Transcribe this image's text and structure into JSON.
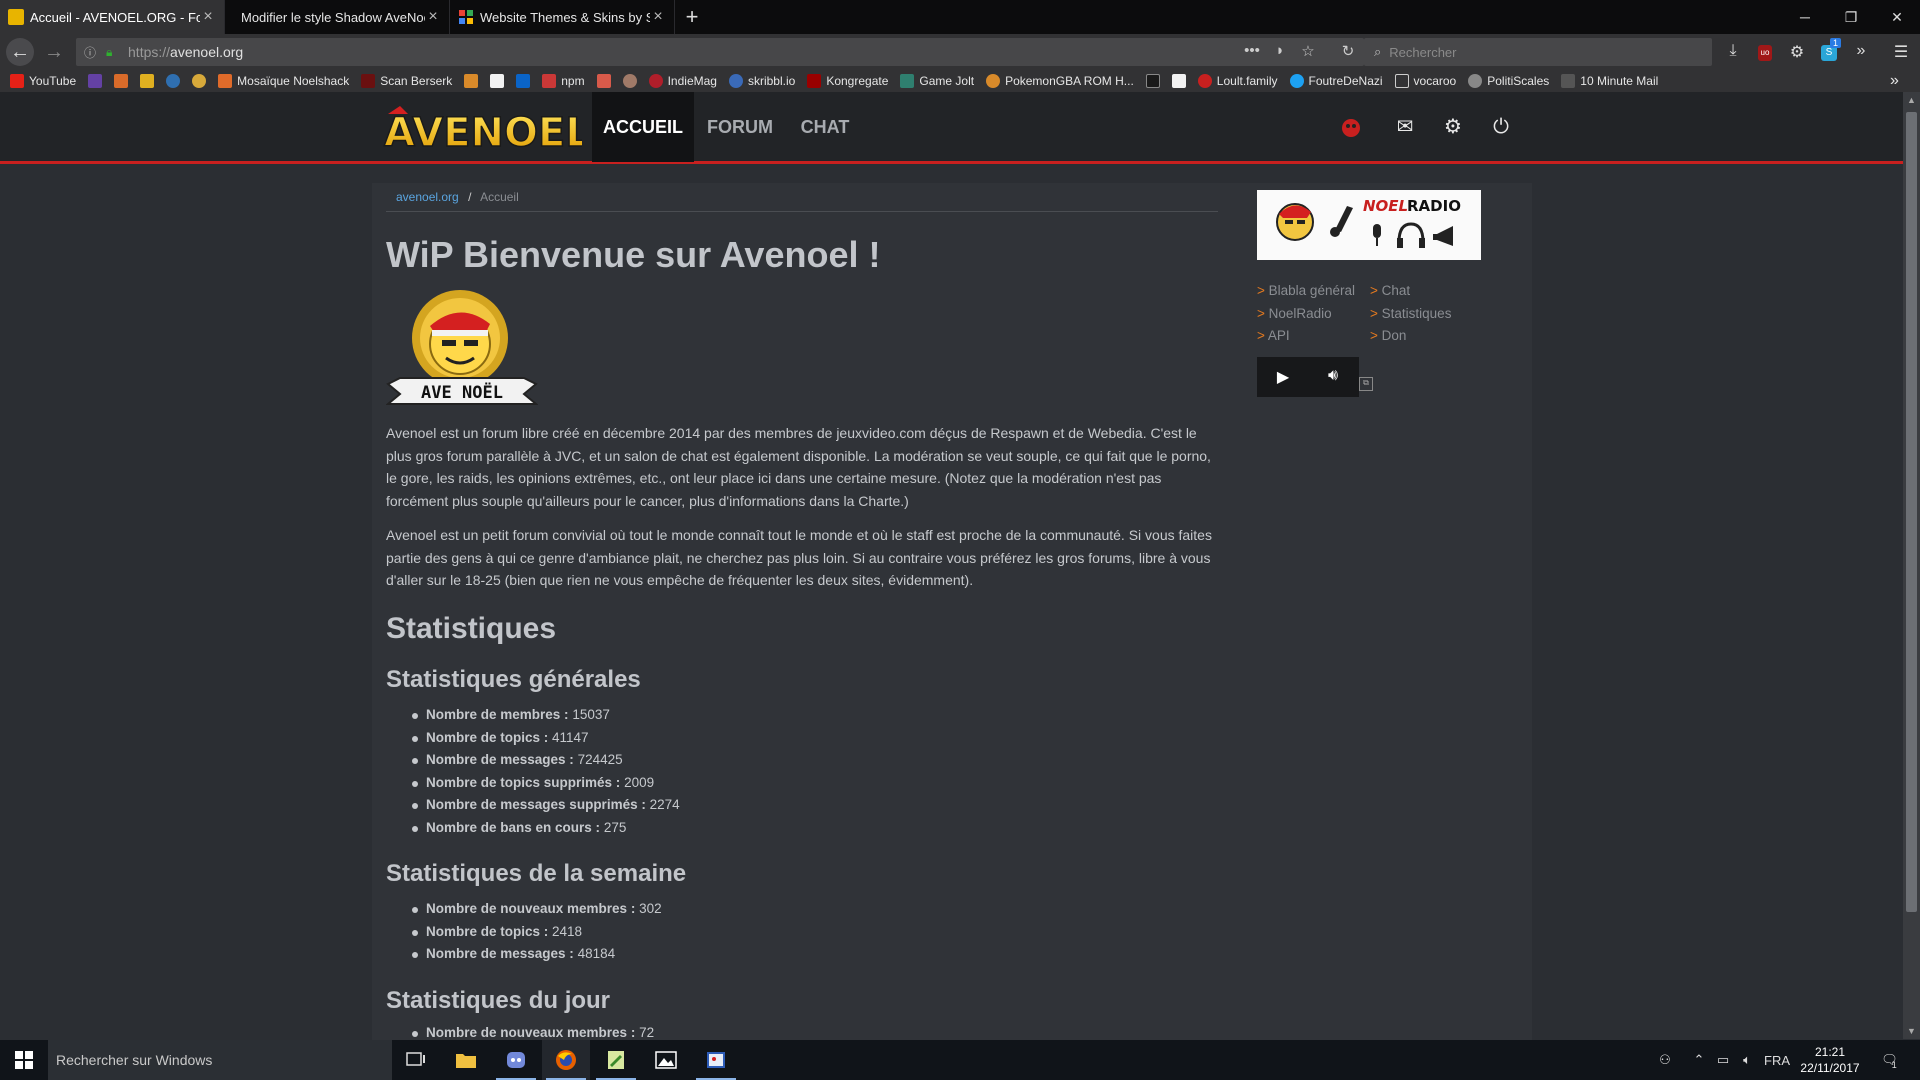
{
  "browser": {
    "tabs": [
      {
        "title": "Accueil - AVENOEL.ORG - Forum",
        "active": true
      },
      {
        "title": "Modifier le style Shadow AveNoël",
        "active": false
      },
      {
        "title": "Website Themes & Skins by Stylish",
        "active": false
      }
    ],
    "url_protocol": "https://",
    "url_host": "avenoel.org",
    "search_placeholder": "Rechercher",
    "bookmarks": [
      "YouTube",
      "Mosaïque Noelshack",
      "Scan Berserk",
      "npm",
      "IndieMag",
      "skribbl.io",
      "Kongregate",
      "Game Jolt",
      "PokemonGBA ROM H...",
      "Loult.family",
      "FoutreDeNazi",
      "vocaroo",
      "PolitiScales",
      "10 Minute Mail"
    ],
    "sync_badge": "1"
  },
  "site": {
    "logo_text": "AVENOEL",
    "nav": [
      "ACCUEIL",
      "FORUM",
      "CHAT"
    ],
    "breadcrumb": {
      "home": "avenoel.org",
      "sep": "/",
      "current": "Accueil"
    },
    "title": "WiP Bienvenue sur Avenoel !",
    "avatar_text": "AVE NOËL",
    "paragraph1": "Avenoel est un forum libre créé en décembre 2014 par des membres de jeuxvideo.com déçus de Respawn et de Webedia. C'est le plus gros forum parallèle à JVC, et un salon de chat est également disponible. La modération se veut souple, ce qui fait que le porno, le gore, les raids, les opinions extrêmes, etc., ont leur place ici dans une certaine mesure. (Notez que la modération n'est pas forcément plus souple qu'ailleurs pour le cancer, plus d'informations dans la Charte.)",
    "paragraph2": "Avenoel est un petit forum convivial où tout le monde connaît tout le monde et où le staff est proche de la communauté. Si vous faites partie des gens à qui ce genre d'ambiance plait, ne cherchez pas plus loin. Si au contraire vous préférez les gros forums, libre à vous d'aller sur le 18-25 (bien que rien ne vous empêche de fréquenter les deux sites, évidemment).",
    "stats_title": "Statistiques",
    "general": {
      "title": "Statistiques générales",
      "items": [
        {
          "label": "Nombre de membres :",
          "value": "15037"
        },
        {
          "label": "Nombre de topics :",
          "value": "41147"
        },
        {
          "label": "Nombre de messages :",
          "value": "724425"
        },
        {
          "label": "Nombre de topics supprimés :",
          "value": "2009"
        },
        {
          "label": "Nombre de messages supprimés :",
          "value": "2274"
        },
        {
          "label": "Nombre de bans en cours :",
          "value": "275"
        }
      ]
    },
    "week": {
      "title": "Statistiques de la semaine",
      "items": [
        {
          "label": "Nombre de nouveaux membres :",
          "value": "302"
        },
        {
          "label": "Nombre de topics :",
          "value": "2418"
        },
        {
          "label": "Nombre de messages :",
          "value": "48184"
        }
      ]
    },
    "day": {
      "title": "Statistiques du jour",
      "items": [
        {
          "label": "Nombre de nouveaux membres :",
          "value": "72"
        }
      ]
    },
    "sidebar": {
      "radio_noel": "NOEL",
      "radio_radio": "RADIO",
      "links": [
        "Blabla général",
        "Chat",
        "NoelRadio",
        "Statistiques",
        "API",
        "Don"
      ],
      "gt": ">"
    }
  },
  "taskbar": {
    "search_placeholder": "Rechercher sur Windows",
    "lang": "FRA",
    "time": "21:21",
    "date": "22/11/2017",
    "notif_count": "1"
  },
  "colors": {
    "accent_red": "#c8201f",
    "link_blue": "#5aa5e0",
    "link_orange": "#e57a1f"
  }
}
